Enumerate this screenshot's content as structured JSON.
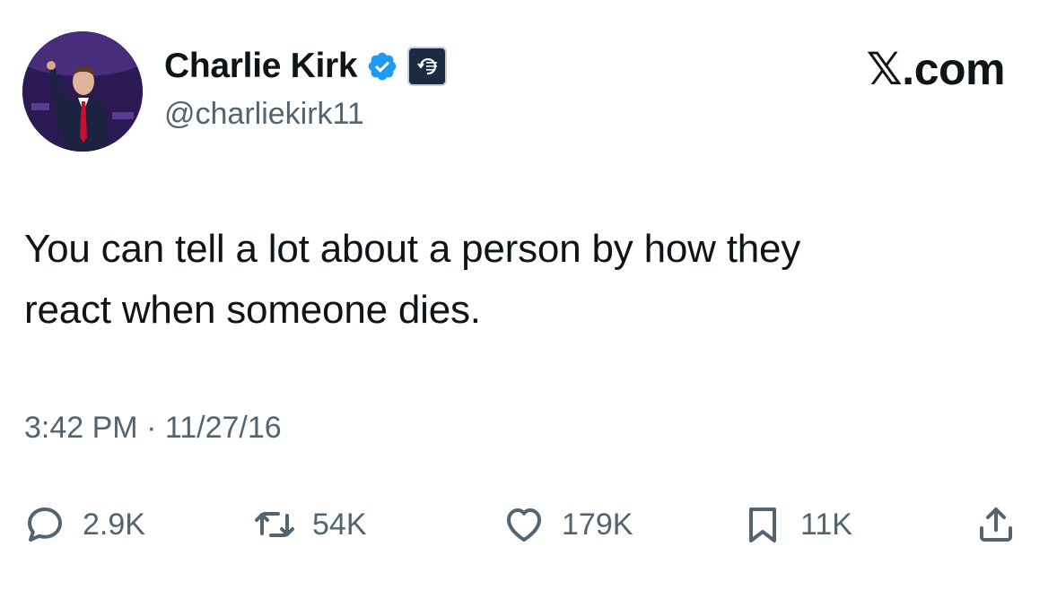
{
  "source": {
    "logo_text": "𝕏.com"
  },
  "author": {
    "display_name": "Charlie Kirk",
    "handle": "@charliekirk11",
    "verified": true,
    "verified_color": "#1d9bf0",
    "affiliate_badge": "turning-point-usa-badge"
  },
  "tweet": {
    "text": "You can tell a lot about a person by how they\nreact when someone dies.",
    "time": "3:42 PM",
    "separator": "·",
    "date": "11/27/16"
  },
  "actions": {
    "reply": {
      "icon": "reply-icon",
      "count": "2.9K"
    },
    "retweet": {
      "icon": "retweet-icon",
      "count": "54K"
    },
    "like": {
      "icon": "heart-icon",
      "count": "179K"
    },
    "bookmark": {
      "icon": "bookmark-icon",
      "count": "11K"
    },
    "share": {
      "icon": "share-icon"
    }
  },
  "colors": {
    "text_primary": "#0f1419",
    "text_secondary": "#536471",
    "verified_blue": "#1d9bf0"
  }
}
